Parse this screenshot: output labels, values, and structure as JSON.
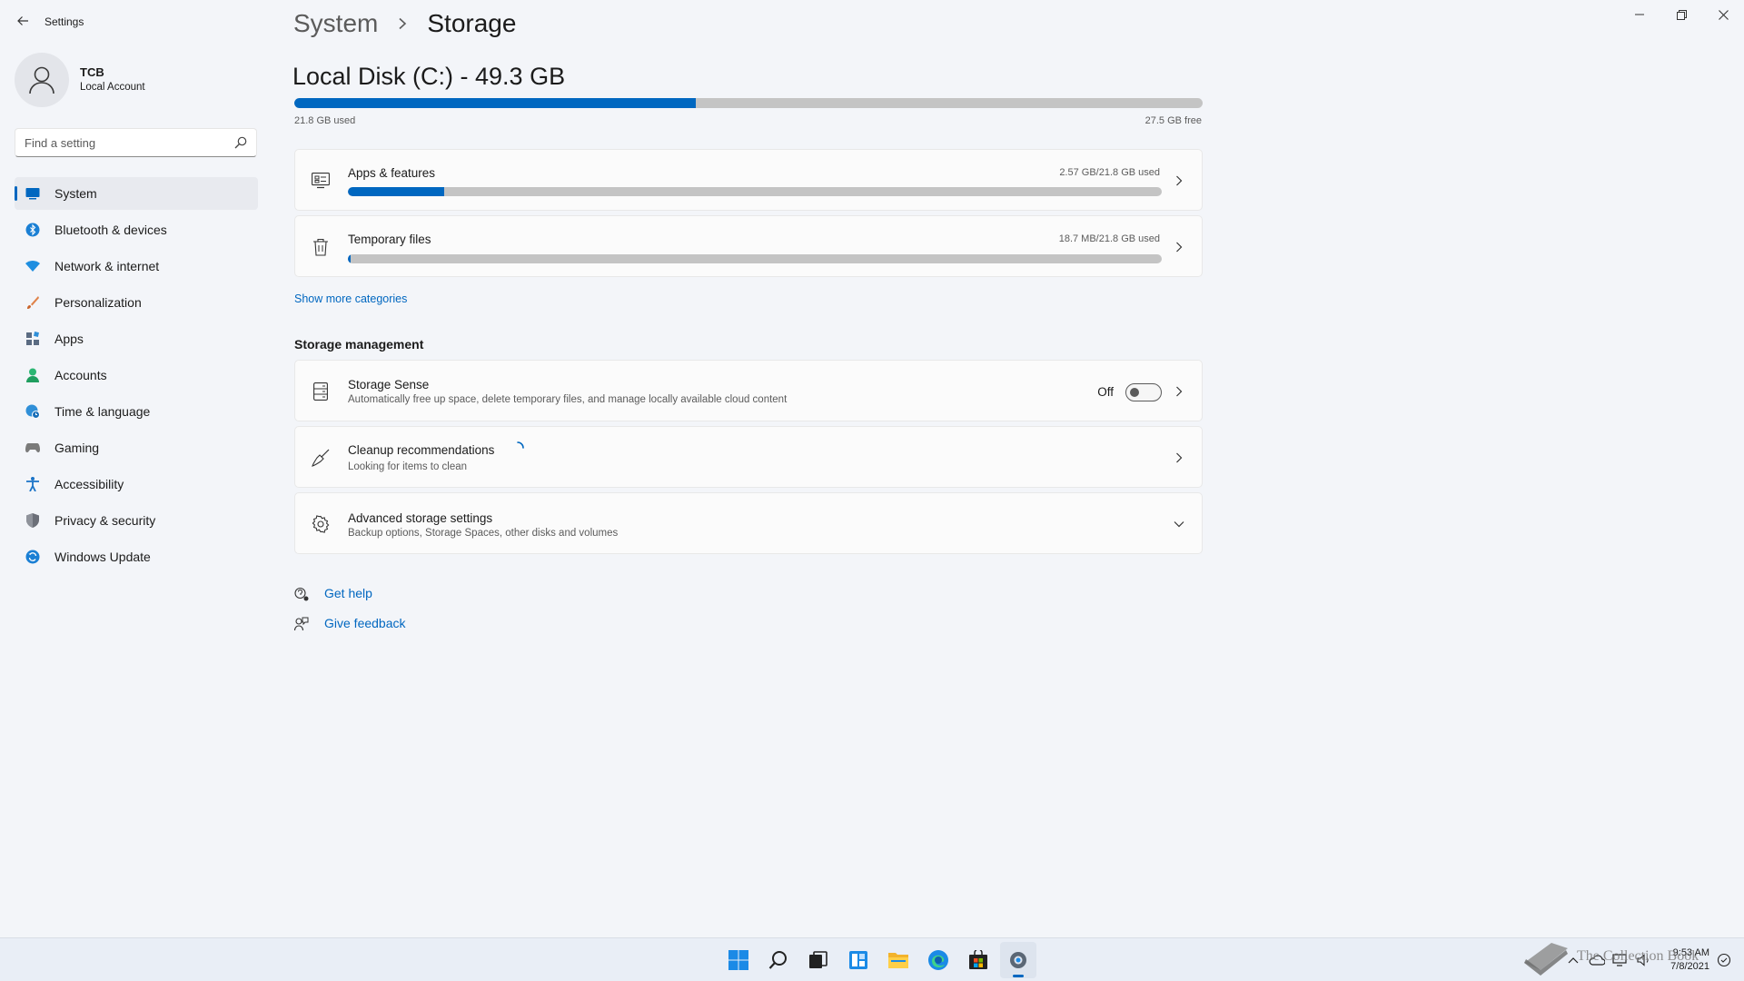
{
  "window": {
    "app_title": "Settings"
  },
  "profile": {
    "name": "TCB",
    "account_type": "Local Account"
  },
  "search": {
    "placeholder": "Find a setting"
  },
  "sidebar": {
    "items": [
      {
        "label": "System",
        "icon": "system-icon",
        "color": "#0067c0",
        "active": true
      },
      {
        "label": "Bluetooth & devices",
        "icon": "bluetooth-icon",
        "color": "#1a7fd4"
      },
      {
        "label": "Network & internet",
        "icon": "wifi-icon",
        "color": "#1e8ee0"
      },
      {
        "label": "Personalization",
        "icon": "brush-icon",
        "color": "#e0834a"
      },
      {
        "label": "Apps",
        "icon": "apps-icon",
        "color": "#5a6b82"
      },
      {
        "label": "Accounts",
        "icon": "person-icon",
        "color": "#2bb673"
      },
      {
        "label": "Time & language",
        "icon": "globe-clock-icon",
        "color": "#2f8fd8"
      },
      {
        "label": "Gaming",
        "icon": "gamepad-icon",
        "color": "#7a7a7a"
      },
      {
        "label": "Accessibility",
        "icon": "accessibility-icon",
        "color": "#1a73c7"
      },
      {
        "label": "Privacy & security",
        "icon": "shield-icon",
        "color": "#6b6f78"
      },
      {
        "label": "Windows Update",
        "icon": "update-icon",
        "color": "#1a7fd4"
      }
    ]
  },
  "header": {
    "breadcrumb_parent": "System",
    "breadcrumb_current": "Storage"
  },
  "disk": {
    "title": "Local Disk (C:) - 49.3 GB",
    "used_label": "21.8 GB used",
    "free_label": "27.5 GB free",
    "used_fraction": 0.442
  },
  "categories": [
    {
      "title": "Apps & features",
      "meta": "2.57 GB/21.8 GB used",
      "fraction": 0.118,
      "icon": "apps-features-icon"
    },
    {
      "title": "Temporary files",
      "meta": "18.7 MB/21.8 GB used",
      "fraction": 0.001,
      "icon": "trash-icon"
    }
  ],
  "show_more_label": "Show more categories",
  "storage_management": {
    "section_title": "Storage management",
    "storage_sense": {
      "title": "Storage Sense",
      "desc": "Automatically free up space, delete temporary files, and manage locally available cloud content",
      "toggle_label": "Off"
    },
    "cleanup": {
      "title": "Cleanup recommendations",
      "desc": "Looking for items to clean"
    },
    "advanced": {
      "title": "Advanced storage settings",
      "desc": "Backup options, Storage Spaces, other disks and volumes"
    }
  },
  "help": {
    "get_help": "Get help",
    "give_feedback": "Give feedback"
  },
  "taskbar": {
    "apps": [
      "start-icon",
      "search-icon",
      "task-view-icon",
      "widgets-icon",
      "file-explorer-icon",
      "edge-icon",
      "store-icon",
      "settings-icon"
    ],
    "time": "9:53 AM",
    "date": "7/8/2021"
  },
  "watermark": {
    "text": "The Collection Book"
  }
}
